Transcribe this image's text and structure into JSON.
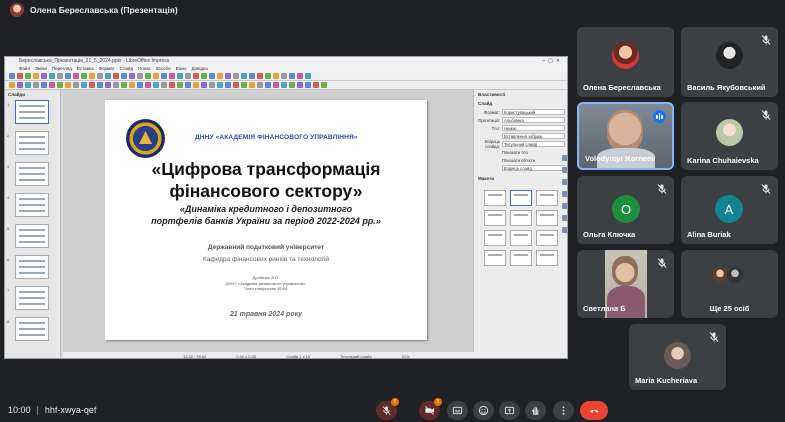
{
  "presenter": {
    "label": "Олена Береславська (Презентація)"
  },
  "app": {
    "window_title": "Береславська_Презентація_21_5_2024.pptx - LibreOffice Impress",
    "menu": [
      "Файл",
      "Зміни",
      "Перегляд",
      "Вставка",
      "Формат",
      "Слайд",
      "Показ",
      "Засоби",
      "Вікно",
      "Довідка"
    ],
    "slides_panel_title": "Слайди",
    "properties_title": "Властивості",
    "properties_section_slide": "Слайд",
    "prop_format_label": "Формат:",
    "prop_format_value": "Користувацький",
    "prop_orientation_label": "Орієнтація:",
    "prop_orientation_value": "Альбомна",
    "prop_tlo_label": "Тло:",
    "prop_tlo_value": "Немає",
    "prop_insert_image": "Вставлення зображ.",
    "prop_master_label": "Взірець слайда:",
    "prop_master_value": "Титульний слайд",
    "prop_show_master": "Показати тло",
    "prop_show_objects": "Показати об'єкти",
    "prop_master_button": "Взірець слайд.",
    "layouts_title": "Макети",
    "status_position": "13,32 / 99,69",
    "status_size": "0,00 x 0,00",
    "status_slide": "Слайд 1 з 15",
    "status_master": "Титульний слайд",
    "status_zoom": "91%"
  },
  "slide": {
    "org": "ДННУ «АКАДЕМІЯ ФІНАНСОВОГО УПРАВЛІННЯ»",
    "title_line1": "«Цифрова трансформація",
    "title_line2": "фінансового сектору»",
    "subtitle_line1": "«Динаміка кредитного і депозитного",
    "subtitle_line2": "портфелів банків України за період 2022-2024 рр.»",
    "university": "Державний податковий університет",
    "department": "Кафедра фінансових ринків та технологій",
    "author_line1": "Дробязко А.О.",
    "author_line2": "ДННУ «Академія фінансового управління»,",
    "author_line3": "Член товариства УЕФА",
    "date": "21 травня 2024 року"
  },
  "participants": [
    {
      "name": "Олена Береславська",
      "muted": false,
      "avatar": "photo"
    },
    {
      "name": "Василь Якубовський",
      "muted": true,
      "avatar": "photo"
    },
    {
      "name": "Volodymyr Korneev",
      "muted": false,
      "speaking": true,
      "avatar": "video"
    },
    {
      "name": "Karina Chuhaievska",
      "muted": true,
      "avatar": "photo"
    },
    {
      "name": "Ольга Ключка",
      "muted": true,
      "avatar_letter": "О",
      "color": "#1e8e3e"
    },
    {
      "name": "Alina Buriak",
      "muted": true,
      "avatar_letter": "A",
      "color": "#12848f"
    },
    {
      "name": "Светлана Б",
      "muted": true,
      "avatar": "video"
    },
    {
      "name": "Ще 25 осіб",
      "muted": false,
      "avatar": "group"
    },
    {
      "name": "Maria Kucheriava",
      "muted": true,
      "avatar": "photo"
    }
  ],
  "meeting": {
    "time": "10:00",
    "separator": "|",
    "code": "hhf-xwya-qef",
    "mic_badge": "!",
    "cam_badge": "!"
  },
  "colors": {
    "speaking": "#1a73e8",
    "end_call": "#ea4335",
    "tile": "#3c4043",
    "background": "#202124"
  }
}
